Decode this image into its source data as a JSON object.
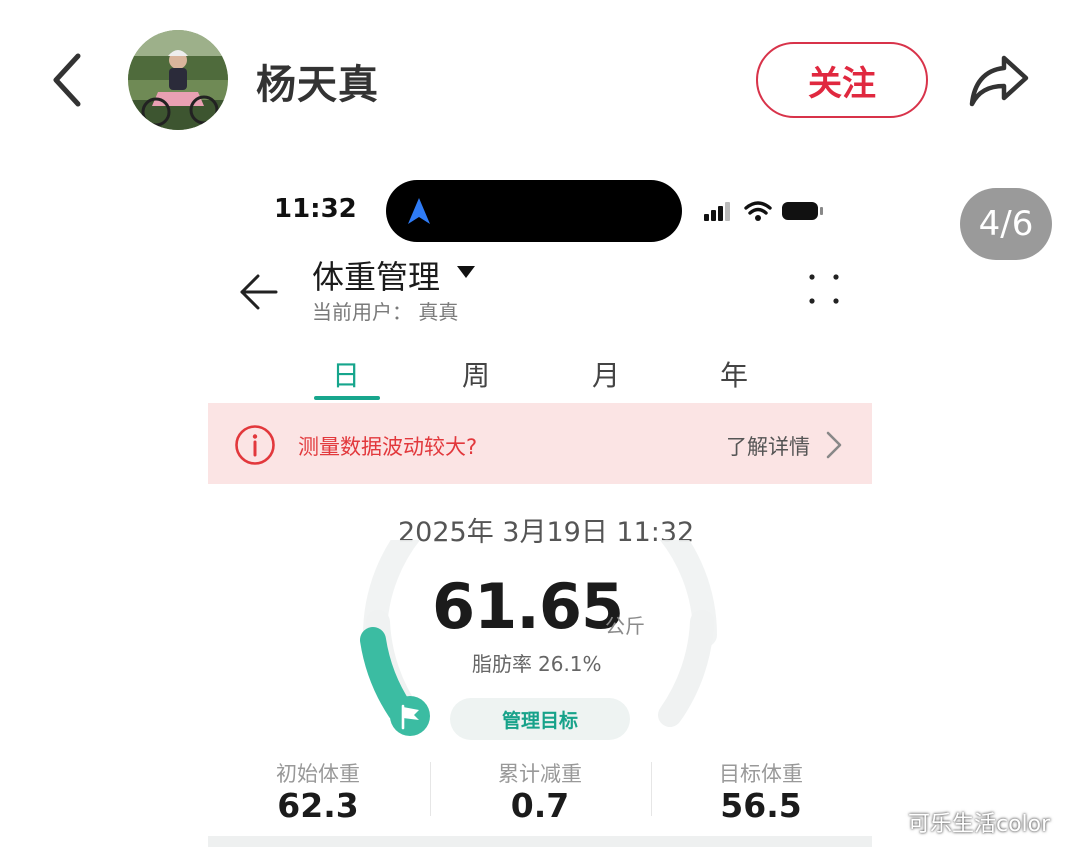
{
  "post_header": {
    "username": "杨天真",
    "follow_label": "关注",
    "page_indicator": "4/6"
  },
  "phone_status": {
    "time": "11:32"
  },
  "app": {
    "title": "体重管理",
    "current_user": "当前用户： 真真",
    "tabs": [
      "日",
      "周",
      "月",
      "年"
    ],
    "active_tab": "日",
    "alert": {
      "text": "测量数据波动较大?",
      "link": "了解详情"
    },
    "record_time": "2025年 3月19日 11:32",
    "weight": {
      "value": "61.65",
      "unit": "公斤",
      "body_fat_label": "脂肪率",
      "body_fat_value": "26.1%",
      "goal_progress": 0.12
    },
    "goal_button": "管理目标",
    "stats": [
      {
        "label": "初始体重",
        "value": "62.3"
      },
      {
        "label": "累计减重",
        "value": "0.7"
      },
      {
        "label": "目标体重",
        "value": "56.5"
      }
    ]
  },
  "watermark": "可乐生活color",
  "colors": {
    "accent_green": "#16a58c",
    "follow_red": "#e0283f",
    "alert_bg": "#fbe4e4",
    "alert_text": "#e2383c"
  }
}
